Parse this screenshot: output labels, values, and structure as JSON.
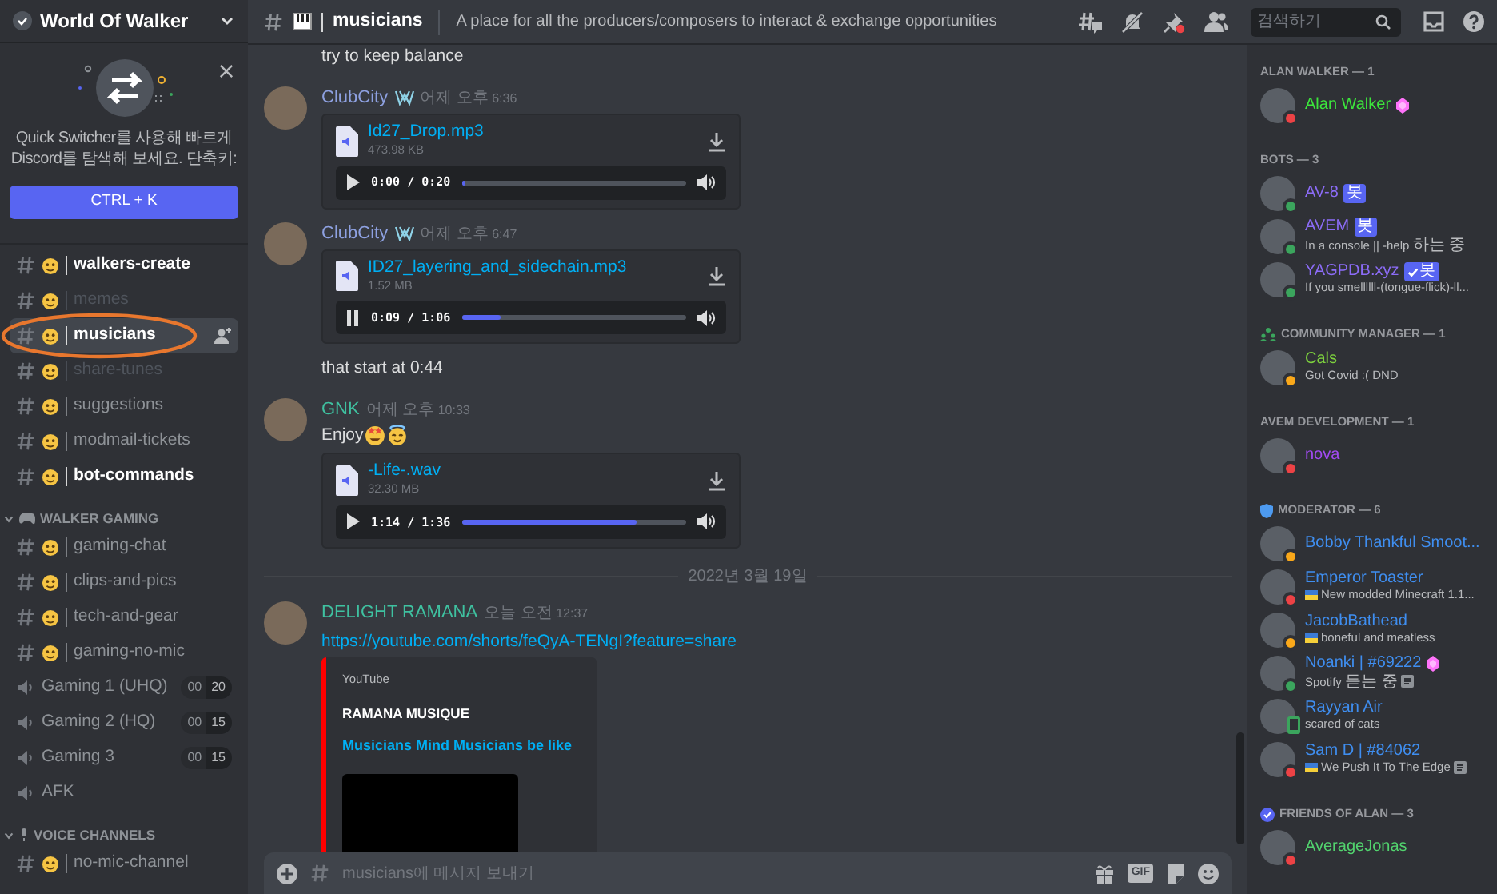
{
  "server": {
    "name": "World Of Walker"
  },
  "quick_switcher": {
    "text": "Quick Switcher를 사용해 빠르게 Discord를 탐색해 보세요. 단축키:",
    "button": "CTRL + K"
  },
  "channel_groups": [
    {
      "kind": "none",
      "channels": [
        {
          "kind": "text",
          "name": "walkers-create",
          "unread": true,
          "muted": false,
          "selected": false,
          "circled": false
        },
        {
          "kind": "text",
          "name": "memes",
          "unread": false,
          "muted": true,
          "selected": false,
          "circled": false
        },
        {
          "kind": "text",
          "name": "musicians",
          "unread": true,
          "muted": false,
          "selected": true,
          "circled": true
        },
        {
          "kind": "text",
          "name": "share-tunes",
          "unread": false,
          "muted": true,
          "selected": false,
          "circled": false
        },
        {
          "kind": "text",
          "name": "suggestions",
          "unread": false,
          "muted": false,
          "selected": false,
          "circled": false
        },
        {
          "kind": "text",
          "name": "modmail-tickets",
          "unread": false,
          "muted": false,
          "selected": false,
          "circled": false
        },
        {
          "kind": "text",
          "name": "bot-commands",
          "unread": true,
          "muted": false,
          "selected": false,
          "circled": false
        }
      ]
    },
    {
      "kind": "gaming",
      "label": "WALKER GAMING",
      "expanded": true,
      "channels": [
        {
          "kind": "text",
          "name": "gaming-chat",
          "unread": false,
          "muted": false,
          "selected": false,
          "circled": false
        },
        {
          "kind": "text",
          "name": "clips-and-pics",
          "unread": false,
          "muted": false,
          "selected": false,
          "circled": false
        },
        {
          "kind": "text",
          "name": "tech-and-gear",
          "unread": false,
          "muted": false,
          "selected": false,
          "circled": false
        },
        {
          "kind": "text",
          "name": "gaming-no-mic",
          "unread": false,
          "muted": false,
          "selected": false,
          "circled": false
        },
        {
          "kind": "voice",
          "name": "Gaming 1 (UHQ)",
          "unread": false,
          "muted": false,
          "selected": false,
          "circled": false,
          "users": "00",
          "limit": "20"
        },
        {
          "kind": "voice",
          "name": "Gaming 2 (HQ)",
          "unread": false,
          "muted": false,
          "selected": false,
          "circled": false,
          "users": "00",
          "limit": "15"
        },
        {
          "kind": "voice",
          "name": "Gaming 3",
          "unread": false,
          "muted": false,
          "selected": false,
          "circled": false,
          "users": "00",
          "limit": "15"
        },
        {
          "kind": "voice",
          "name": "AFK",
          "unread": false,
          "muted": false,
          "selected": false,
          "circled": false
        }
      ]
    },
    {
      "kind": "voice",
      "label": "VOICE CHANNELS",
      "expanded": true,
      "channels": [
        {
          "kind": "text",
          "name": "no-mic-channel",
          "unread": false,
          "muted": false,
          "selected": false,
          "circled": false
        }
      ]
    }
  ],
  "header": {
    "channel": "musicians",
    "topic": "A place for all the producers/composers to interact & exchange opportunities",
    "search": {
      "placeholder": "검색하기"
    }
  },
  "messages": [
    {
      "kind": "continuation",
      "text": "try to keep balance"
    },
    {
      "kind": "message",
      "author": "ClubCity",
      "color": "#8ea1e1",
      "role_icon": true,
      "timestamp": "어제 오후 6:36",
      "blocks": [
        {
          "kind": "audio",
          "filename": "Id27_Drop.mp3",
          "size": "473.98 KB",
          "playing": false,
          "time": "0:00 / 0:20",
          "level": 0.02
        }
      ]
    },
    {
      "kind": "message",
      "author": "ClubCity",
      "color": "#8ea1e1",
      "role_icon": true,
      "timestamp": "어제 오후 6:47",
      "blocks": [
        {
          "kind": "audio",
          "filename": "ID27_layering_and_sidechain.mp3",
          "size": "1.52 MB",
          "playing": true,
          "time": "0:09 / 1:06",
          "level": 0.17
        }
      ]
    },
    {
      "kind": "continuation",
      "text": "that start at 0:44"
    },
    {
      "kind": "message",
      "author": "GNK",
      "color": "#3fc1a0",
      "role_icon": false,
      "timestamp": "어제 오후 10:33",
      "blocks": [
        {
          "kind": "text_emoji",
          "text": "Enjoy"
        },
        {
          "kind": "audio",
          "filename": "-Life-.wav",
          "size": "32.30 MB",
          "playing": false,
          "time": "1:14 / 1:36",
          "level": 0.78
        }
      ]
    },
    {
      "kind": "date",
      "text": "2022년 3월 19일"
    },
    {
      "kind": "message",
      "author": "DELIGHT RAMANA",
      "color": "#3fc1a0",
      "role_icon": false,
      "timestamp": "오늘 오전 12:37",
      "blocks": [
        {
          "kind": "link",
          "text": "https://youtube.com/shorts/feQyA-TENgI?feature=share"
        },
        {
          "kind": "embed",
          "provider": "YouTube",
          "author": "RAMANA MUSIQUE",
          "title": "Musicians Mind Musicians be like",
          "color": "#ff0000"
        }
      ]
    }
  ],
  "composer": {
    "placeholder": "musicians에 메시지 보내기",
    "gif_label": "GIF"
  },
  "member_groups": [
    {
      "kind": "plain",
      "label": "ALAN WALKER — 1",
      "members": [
        {
          "name": "Alan Walker",
          "color": "#3ce63c",
          "status": {
            "color": "#ed4245",
            "mobile": false
          },
          "boosting": true
        }
      ]
    },
    {
      "kind": "plain",
      "label": "BOTS — 3",
      "members": [
        {
          "name": "AV-8",
          "color": "#8c6cf7",
          "status": {
            "color": "#3ba55d",
            "mobile": false
          },
          "bot_tag": "봇",
          "verified": false
        },
        {
          "name": "AVEM",
          "color": "#8c6cf7",
          "status": {
            "color": "#3ba55d",
            "mobile": false
          },
          "bot_tag": "봇",
          "verified": false,
          "activity": "In a console || -help 하는 중"
        },
        {
          "name": "YAGPDB.xyz",
          "color": "#8c6cf7",
          "status": {
            "color": "#3ba55d",
            "mobile": false
          },
          "bot_tag": "봇",
          "verified": true,
          "activity": "If you smellllll-(tongue-flick)-ll..."
        }
      ]
    },
    {
      "kind": "community",
      "label": "COMMUNITY MANAGER — 1",
      "members": [
        {
          "name": "Cals",
          "color": "#7dd13e",
          "status": {
            "color": "#faa81a",
            "mobile": false
          },
          "activity": "Got Covid :( DND"
        }
      ]
    },
    {
      "kind": "plain",
      "label": "AVEM DEVELOPMENT — 1",
      "members": [
        {
          "name": "nova",
          "color": "#a24bf2",
          "status": {
            "color": "#ed4245",
            "mobile": false
          }
        }
      ]
    },
    {
      "kind": "shield",
      "label": "MODERATOR — 6",
      "members": [
        {
          "name": "Bobby Thankful Smoot...",
          "color": "#3f8ef0",
          "status": {
            "color": "#faa81a",
            "mobile": false
          }
        },
        {
          "name": "Emperor Toaster",
          "color": "#3f8ef0",
          "status": {
            "color": "#ed4245",
            "mobile": false
          },
          "activity": "New modded Minecraft 1.1...",
          "activity_emoji": true
        },
        {
          "name": "JacobBathead",
          "color": "#3f8ef0",
          "status": {
            "color": "#faa81a",
            "mobile": false
          },
          "activity": "boneful and meatless",
          "activity_emoji": true
        },
        {
          "name": "Noanki | #69222",
          "color": "#3f8ef0",
          "status": {
            "color": "#3ba55d",
            "mobile": false
          },
          "boosting": true,
          "activity": "Spotify 듣는 중",
          "rich_presence": true
        },
        {
          "name": "Rayyan Air",
          "color": "#3f8ef0",
          "status": {
            "color": "#3ba55d",
            "mobile": true
          },
          "activity": "scared of cats"
        },
        {
          "name": "Sam D | #84062",
          "color": "#3f8ef0",
          "status": {
            "color": "#ed4245",
            "mobile": false
          },
          "activity": "We Push It To The Edge",
          "activity_emoji": true,
          "rich_presence": true
        }
      ]
    },
    {
      "kind": "badge",
      "label": "FRIENDS OF ALAN — 3",
      "members": [
        {
          "name": "AverageJonas",
          "color": "#52d36e",
          "status": {
            "color": "#ed4245",
            "mobile": false
          }
        }
      ]
    }
  ]
}
